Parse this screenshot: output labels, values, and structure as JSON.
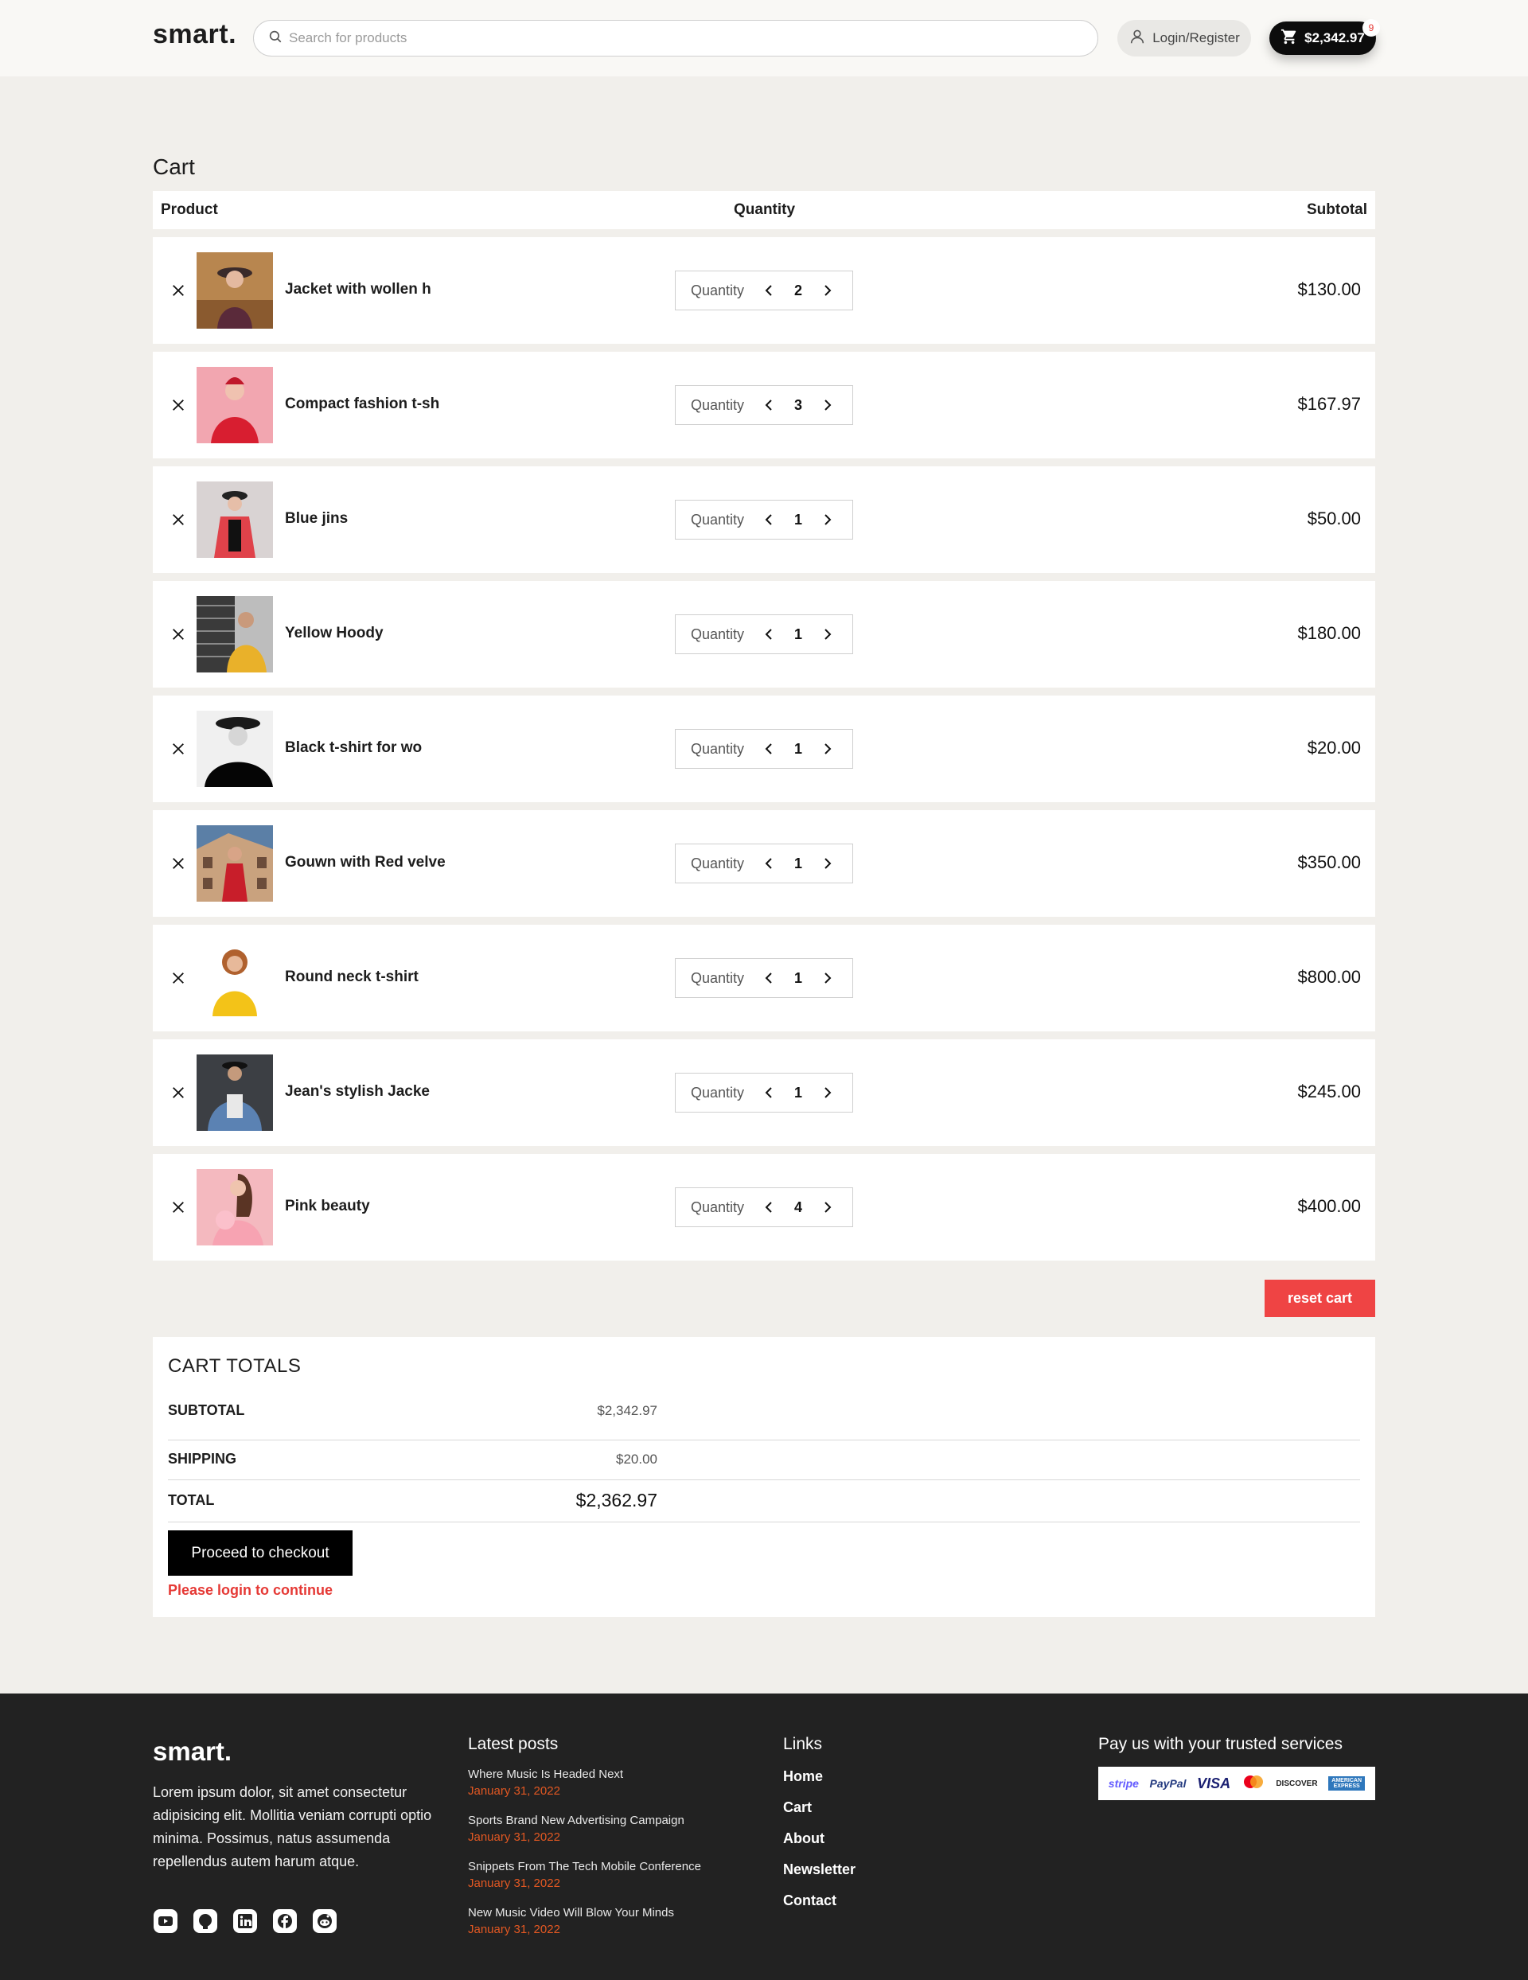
{
  "header": {
    "logo": "smart.",
    "search_placeholder": "Search for products",
    "login_label": "Login/Register",
    "cart_total": "$2,342.97",
    "cart_count": "9"
  },
  "cart": {
    "title": "Cart",
    "columns": {
      "product": "Product",
      "quantity": "Quantity",
      "subtotal": "Subtotal"
    },
    "quantity_label": "Quantity",
    "items": [
      {
        "name": "Jacket with wollen h",
        "qty": "2",
        "subtotal": "$130.00"
      },
      {
        "name": "Compact fashion t-sh",
        "qty": "3",
        "subtotal": "$167.97"
      },
      {
        "name": "Blue jins",
        "qty": "1",
        "subtotal": "$50.00"
      },
      {
        "name": "Yellow Hoody",
        "qty": "1",
        "subtotal": "$180.00"
      },
      {
        "name": "Black t-shirt for wo",
        "qty": "1",
        "subtotal": "$20.00"
      },
      {
        "name": "Gouwn with Red velve",
        "qty": "1",
        "subtotal": "$350.00"
      },
      {
        "name": "Round neck t-shirt",
        "qty": "1",
        "subtotal": "$800.00"
      },
      {
        "name": "Jean's stylish Jacke",
        "qty": "1",
        "subtotal": "$245.00"
      },
      {
        "name": "Pink beauty",
        "qty": "4",
        "subtotal": "$400.00"
      }
    ],
    "reset_label": "reset cart"
  },
  "totals": {
    "title": "CART TOTALS",
    "subtotal_label": "SUBTOTAL",
    "subtotal_value": "$2,342.97",
    "shipping_label": "SHIPPING",
    "shipping_value": "$20.00",
    "total_label": "TOTAL",
    "total_value": "$2,362.97",
    "checkout_label": "Proceed to checkout",
    "login_message": "Please login to continue"
  },
  "footer": {
    "logo": "smart.",
    "about": "Lorem ipsum dolor, sit amet consectetur adipisicing elit. Mollitia veniam corrupti optio minima. Possimus, natus assumenda repellendus autem harum atque.",
    "posts_title": "Latest posts",
    "posts": [
      {
        "title": "Where Music Is Headed Next",
        "date": "January 31, 2022"
      },
      {
        "title": "Sports Brand New Advertising Campaign",
        "date": "January 31, 2022"
      },
      {
        "title": "Snippets From The Tech Mobile Conference",
        "date": "January 31, 2022"
      },
      {
        "title": "New Music Video Will Blow Your Minds",
        "date": "January 31, 2022"
      }
    ],
    "links_title": "Links",
    "links": [
      "Home",
      "Cart",
      "About",
      "Newsletter",
      "Contact"
    ],
    "payments_title": "Pay us with your trusted services",
    "payment_methods": [
      "stripe",
      "PayPal",
      "VISA",
      "DISCOVER",
      "AMERICAN EXPRESS"
    ]
  },
  "colors": {
    "page_bg": "#f1efeb",
    "accent_red": "#ef4444",
    "footer_bg": "#222222",
    "post_date": "#e25822"
  }
}
